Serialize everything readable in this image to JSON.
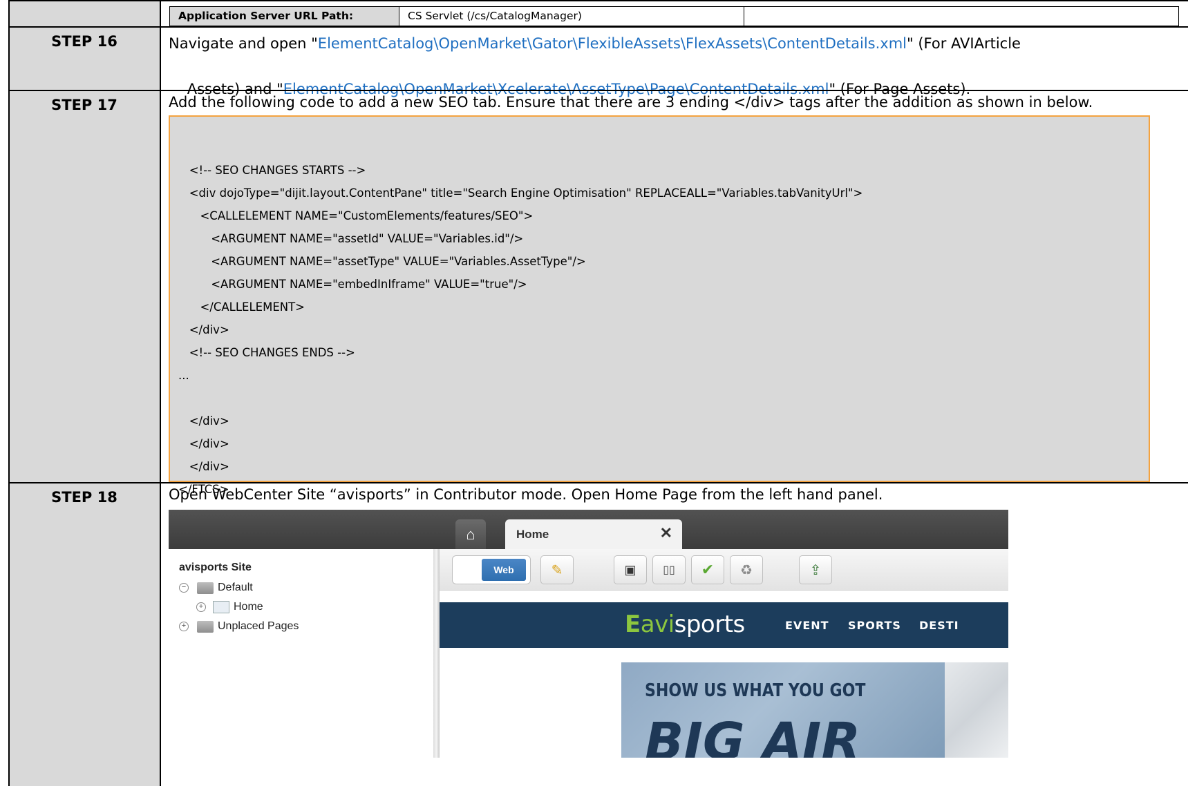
{
  "header_row": {
    "label": "Application Server URL Path:",
    "value": "CS Servlet (/cs/CatalogManager)"
  },
  "step16": {
    "label": "STEP 16",
    "line1_prefix": "Navigate and open \"",
    "line1_link": "ElementCatalog\\OpenMarket\\Gator\\FlexibleAssets\\FlexAssets\\ContentDetails.xml",
    "line1_suffix": "\" (For AVIArticle",
    "line2_prefix": "Assets) and \"",
    "line2_link": "ElementCatalog\\OpenMarket\\Xcelerate\\AssetType\\Page\\ContentDetails.xml",
    "line2_suffix": "\" (For Page Assets)."
  },
  "step17": {
    "label": "STEP 17",
    "text": "Add the following code to add a new SEO tab. Ensure that there are 3 ending </div> tags after the addition as shown in below.",
    "code_lines": [
      "",
      "   <!-- SEO CHANGES STARTS -->",
      "   <div dojoType=\"dijit.layout.ContentPane\" title=\"Search Engine Optimisation\" REPLACEALL=\"Variables.tabVanityUrl\">",
      "      <CALLELEMENT NAME=\"CustomElements/features/SEO\">",
      "         <ARGUMENT NAME=\"assetId\" VALUE=\"Variables.id\"/>",
      "         <ARGUMENT NAME=\"assetType\" VALUE=\"Variables.AssetType\"/>",
      "         <ARGUMENT NAME=\"embedInIframe\" VALUE=\"true\"/>",
      "      </CALLELEMENT>",
      "   </div>",
      "   <!-- SEO CHANGES ENDS -->",
      "...",
      "",
      "   </div>",
      "   </div>",
      "   </div>",
      "</FTCS>"
    ]
  },
  "step18": {
    "label": "STEP 18",
    "text": "Open WebCenter Site “avisports” in Contributor mode. Open Home Page from the left hand panel.",
    "screenshot": {
      "tab_label": "Home",
      "tree_title": "avisports Site",
      "tree_items": [
        "Default",
        "Home",
        "Unplaced Pages"
      ],
      "web_button": "Web",
      "logo_prefix": "avi",
      "logo_suffix": "sports",
      "nav_items": [
        "EVENT",
        "SPORTS",
        "DESTI"
      ],
      "banner_line1": "SHOW US WHAT YOU GOT",
      "banner_line2": "BIG AIR",
      "colors": {
        "nav_band": "#1c3d5c",
        "accent_green": "#8cc63f",
        "toolbar_blue": "#2f6fb0"
      }
    }
  },
  "colors": {
    "step_cell_bg": "#d9d9d9",
    "link": "#1f6fc1",
    "code_border": "#f4a340"
  }
}
